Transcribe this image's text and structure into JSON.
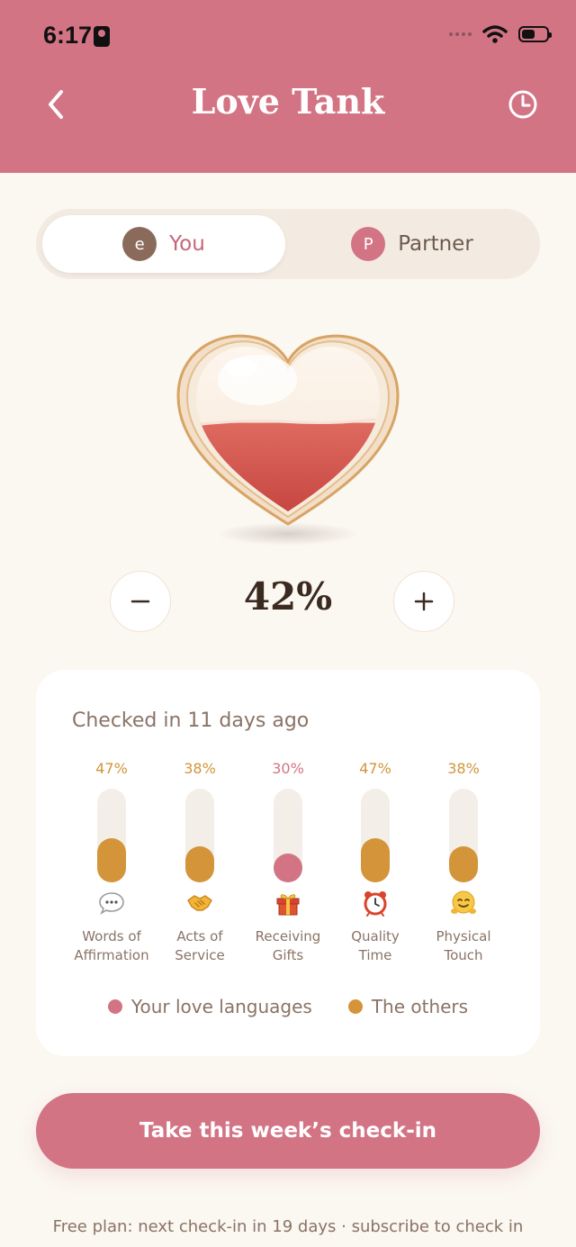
{
  "status_bar": {
    "time": "6:17"
  },
  "header": {
    "title": "Love Tank"
  },
  "segment": {
    "you": {
      "avatar_letter": "e",
      "label": "You"
    },
    "partner": {
      "avatar_letter": "P",
      "label": "Partner"
    }
  },
  "tank": {
    "percent_label": "42%",
    "fill_level": 0.42
  },
  "card": {
    "title": "Checked in 11 days ago",
    "languages": [
      {
        "pct_label": "47%",
        "level": 0.47,
        "line1": "Words of",
        "line2": "Affirmation",
        "icon": "speech-bubble-icon",
        "highlight": false
      },
      {
        "pct_label": "38%",
        "level": 0.38,
        "line1": "Acts of",
        "line2": "Service",
        "icon": "handshake-icon",
        "highlight": false
      },
      {
        "pct_label": "30%",
        "level": 0.3,
        "line1": "Receiving",
        "line2": "Gifts",
        "icon": "gift-icon",
        "highlight": true
      },
      {
        "pct_label": "47%",
        "level": 0.47,
        "line1": "Quality",
        "line2": "Time",
        "icon": "alarm-clock-icon",
        "highlight": false
      },
      {
        "pct_label": "38%",
        "level": 0.38,
        "line1": "Physical",
        "line2": "Touch",
        "icon": "hug-icon",
        "highlight": false
      }
    ],
    "legend": {
      "yours": "Your love languages",
      "others": "The others"
    }
  },
  "cta_label": "Take this week’s check-in",
  "footnote": "Free plan: next check-in in 19 days · subscribe to check in",
  "colors": {
    "accent": "#D37485",
    "gold": "#D3943A",
    "background": "#FBF7F1"
  }
}
